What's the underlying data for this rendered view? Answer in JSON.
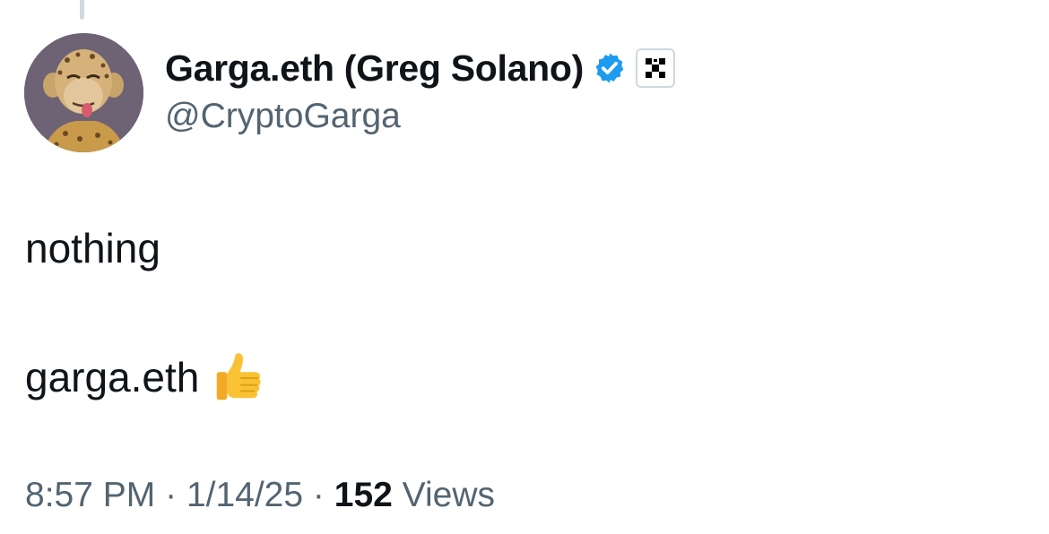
{
  "author": {
    "display_name": "Garga.eth (Greg Solano)",
    "handle": "@CryptoGarga",
    "verified_icon": "verified-check-icon",
    "verified_color": "#1d9bf0",
    "affiliate_badge_icon": "organization-badge-icon"
  },
  "tweet": {
    "lines": [
      "nothing",
      "garga.eth"
    ],
    "emoji_icon": "thumbs-up-emoji-icon"
  },
  "meta": {
    "time": "8:57 PM",
    "separator": "·",
    "date": "1/14/25",
    "views_count": "152",
    "views_label": "Views"
  },
  "colors": {
    "text_primary": "#0f1419",
    "text_secondary": "#536471",
    "accent": "#1d9bf0",
    "thread_line": "#cfd9de"
  }
}
